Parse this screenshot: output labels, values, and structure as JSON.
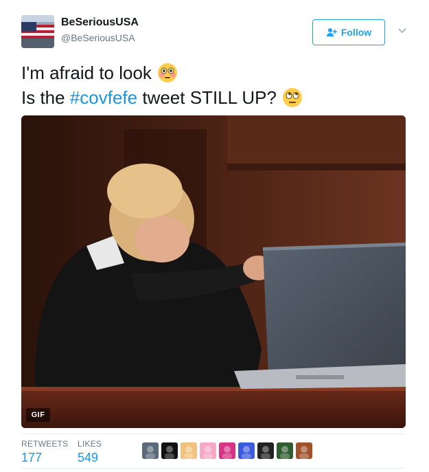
{
  "author": {
    "display_name": "BeSeriousUSA",
    "handle": "@BeSeriousUSA",
    "avatar_icon": "us-flag-avatar"
  },
  "follow_button": {
    "label": "Follow",
    "icon": "add-user-icon"
  },
  "menu_icon": "chevron-down-icon",
  "text": {
    "line1": "I'm afraid to look",
    "line1_emoji": "flushed-face-emoji",
    "line2_prefix": "Is the ",
    "hashtag": "#covfefe",
    "line2_suffix": " tweet STILL UP?",
    "line2_emoji": "eye-roll-emoji"
  },
  "media": {
    "type": "gif",
    "badge": "GIF"
  },
  "stats": {
    "retweets_label": "RETWEETS",
    "retweets_value": "177",
    "likes_label": "LIKES",
    "likes_value": "549"
  },
  "liker_avatars": [
    {
      "color": "#5a6a7a"
    },
    {
      "color": "#111111"
    },
    {
      "color": "#f1c27d"
    },
    {
      "color": "#f7a8c4"
    },
    {
      "color": "#d63384"
    },
    {
      "color": "#3b5bdb"
    },
    {
      "color": "#222222"
    },
    {
      "color": "#2f5d2f"
    },
    {
      "color": "#a0522d"
    }
  ],
  "colors": {
    "accent": "#1da1f2",
    "link": "#1b95e0",
    "muted": "#657786",
    "text": "#14171a"
  }
}
